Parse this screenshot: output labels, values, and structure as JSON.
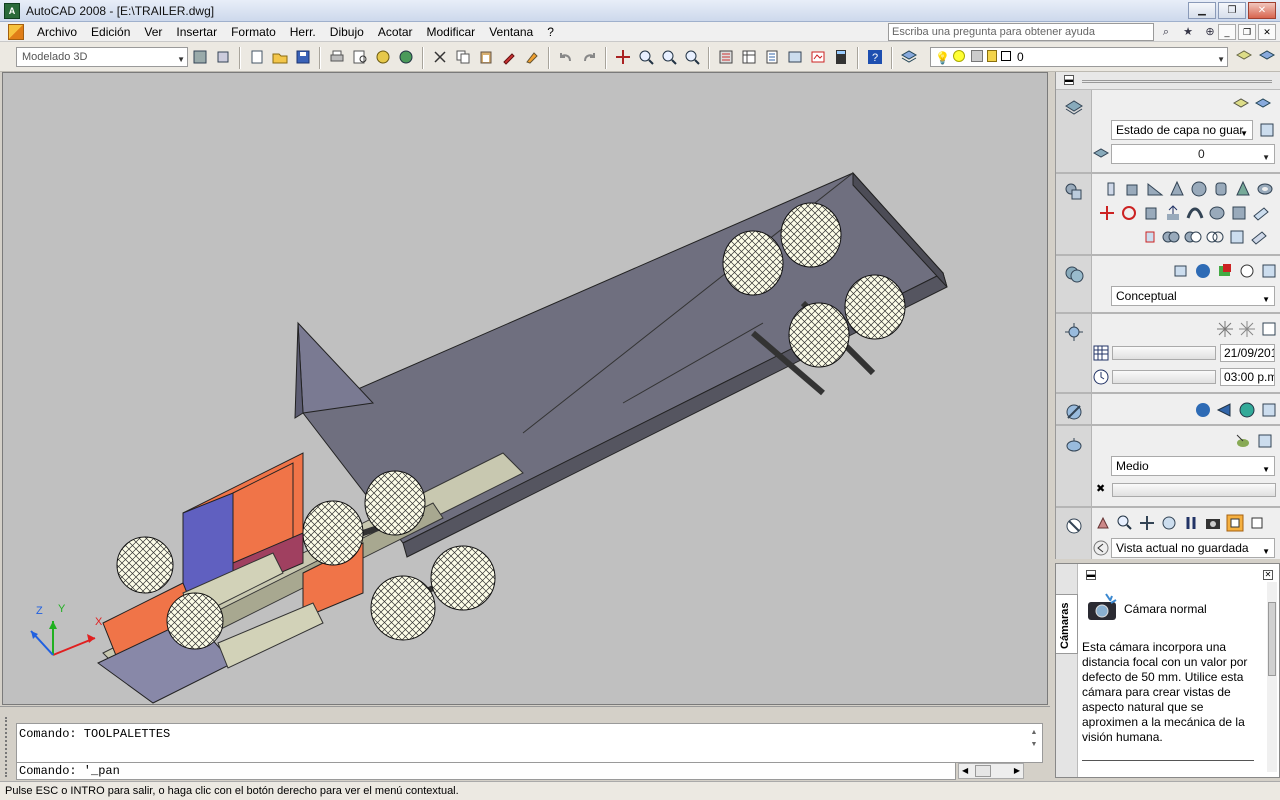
{
  "titlebar": {
    "app_icon_label": "A",
    "title": "AutoCAD 2008 - [E:\\TRAILER.dwg]"
  },
  "menubar": {
    "items": [
      "Archivo",
      "Edición",
      "Ver",
      "Insertar",
      "Formato",
      "Herr.",
      "Dibujo",
      "Acotar",
      "Modificar",
      "Ventana",
      "?"
    ],
    "help_placeholder": "Escriba una pregunta para obtener ayuda"
  },
  "toolbar": {
    "workspace": "Modelado 3D",
    "layer_value": "0"
  },
  "command": {
    "history_line": "Comando: TOOLPALETTES",
    "current_line": "Comando: '_pan"
  },
  "status": {
    "text": "Pulse ESC o INTRO para salir, o haga clic con el botón derecho para ver el menú contextual."
  },
  "dashboard": {
    "layers": {
      "layer_state": "Estado de capa no guar",
      "layer_current": "0"
    },
    "visual_style": "Conceptual",
    "sun": {
      "date": "21/09/201",
      "time": "03:00 p.m"
    },
    "render_quality": "Medio",
    "view": "Vista actual no guardada"
  },
  "palette": {
    "tab_label": "Cámaras",
    "item_title": "Cámara normal",
    "item_description": "Esta cámara incorpora una distancia focal con un valor por defecto de 50 mm. Utilice esta cámara para crear vistas de aspecto natural que se aproximen a la mecánica de la visión humana."
  },
  "ucs": {
    "x_label": "X",
    "y_label": "Y",
    "z_label": "Z"
  },
  "colors": {
    "viewport": "#c0c0c0",
    "cab": "#f07448",
    "trailer": "#6f6f7f",
    "tire": "#fdfde8"
  }
}
